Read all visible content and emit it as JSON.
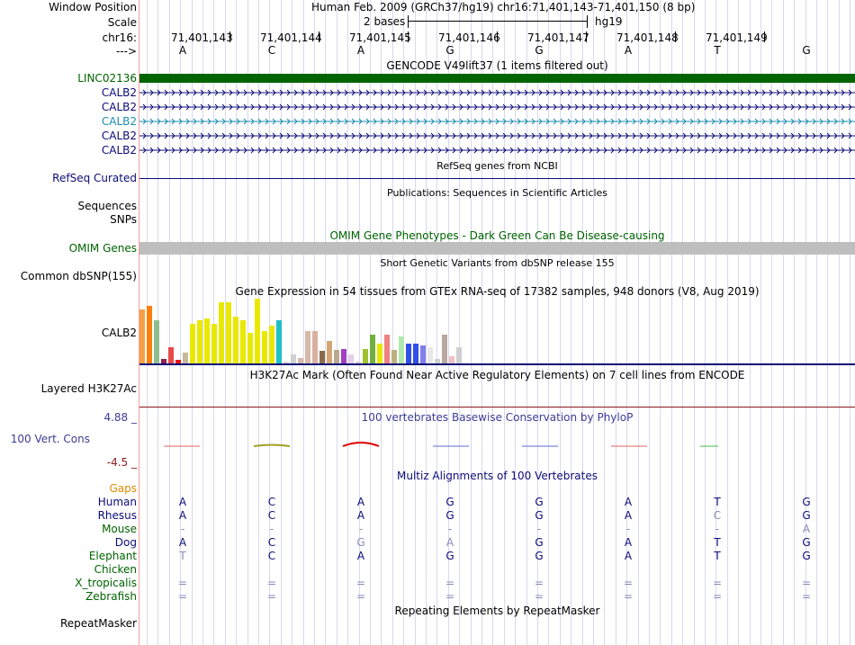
{
  "header": {
    "window_position_label": "Window Position",
    "window_position_value": "Human Feb. 2009 (GRCh37/hg19)   chr16:71,401,143-71,401,150 (8 bp)",
    "scale_label": "Scale",
    "scale_value": "2 bases",
    "scale_assembly": "hg19",
    "chrom_label": "chr16:",
    "strand_label": "--->",
    "positions": [
      "71,401,143",
      "71,401,144",
      "71,401,145",
      "71,401,146",
      "71,401,147",
      "71,401,148",
      "71,401,149"
    ],
    "bases": [
      "A",
      "C",
      "A",
      "G",
      "G",
      "A",
      "T",
      "G"
    ]
  },
  "gencode": {
    "title": "GENCODE V49lift37 (1 items filtered out)",
    "tracks": [
      {
        "label": "LINC02136",
        "color": "#006400"
      },
      {
        "label": "CALB2",
        "color": "#0c0c78"
      },
      {
        "label": "CALB2",
        "color": "#0c0c78"
      },
      {
        "label": "CALB2",
        "color": "#1a8cad"
      },
      {
        "label": "CALB2",
        "color": "#0c0c78"
      },
      {
        "label": "CALB2",
        "color": "#0c0c78"
      }
    ]
  },
  "refseq": {
    "title": "RefSeq genes from NCBI",
    "label": "RefSeq Curated"
  },
  "publications": {
    "title": "Publications: Sequences in Scientific Articles",
    "label": "Sequences"
  },
  "snps_label": "SNPs",
  "omim": {
    "title": "OMIM Gene Phenotypes - Dark Green Can Be Disease-causing",
    "label": "OMIM Genes"
  },
  "dbsnp": {
    "title": "Short Genetic Variants from dbSNP release 155",
    "label": "Common dbSNP(155)"
  },
  "gtex": {
    "title": "Gene Expression in 54 tissues from GTEx RNA-seq of 17382 samples, 948 donors (V8, Aug 2019)",
    "label": "CALB2"
  },
  "h3k27ac": {
    "title": "H3K27Ac Mark (Often Found Near Active Regulatory Elements) on 7 cell lines from ENCODE",
    "label": "Layered H3K27Ac"
  },
  "conservation": {
    "title": "100 vertebrates Basewise Conservation by PhyloP",
    "label": "100 Vert. Cons",
    "max_label": "4.88 _",
    "min_label": "-4.5 _"
  },
  "multiz": {
    "title": "Multiz Alignments of 100 Vertebrates",
    "gaps_label": "Gaps",
    "species": [
      {
        "name": "Human",
        "bases": [
          "A",
          "C",
          "A",
          "G",
          "G",
          "A",
          "T",
          "G"
        ]
      },
      {
        "name": "Rhesus",
        "bases": [
          "A",
          "C",
          "A",
          "G",
          "G",
          "A",
          "C",
          "G"
        ]
      },
      {
        "name": "Mouse",
        "bases": [
          "-",
          "-",
          "-",
          "-",
          "-",
          "-",
          "-",
          "A"
        ]
      },
      {
        "name": "Dog",
        "bases": [
          "A",
          "C",
          "G",
          "A",
          "G",
          "A",
          "T",
          "G"
        ]
      },
      {
        "name": "Elephant",
        "bases": [
          "T",
          "C",
          "A",
          "G",
          "G",
          "A",
          "T",
          "G"
        ]
      },
      {
        "name": "Chicken",
        "bases": [
          "",
          "",
          "",
          "",
          "",
          "",
          "",
          ""
        ]
      },
      {
        "name": "X_tropicalis",
        "bases": [
          "=",
          "=",
          "=",
          "=",
          "=",
          "=",
          "=",
          "="
        ]
      },
      {
        "name": "Zebrafish",
        "bases": [
          "=",
          "=",
          "=",
          "=",
          "=",
          "=",
          "=",
          "="
        ]
      }
    ]
  },
  "repeatmasker": {
    "title": "Repeating Elements by RepeatMasker",
    "label": "RepeatMasker"
  },
  "colors": {
    "gene_dark_green": "#006400",
    "gene_navy": "#0c0c78",
    "omim_gray": "#bebebe",
    "label_blue": "#0c0c78",
    "label_green": "#006400",
    "gaps_orange": "#e08a00"
  }
}
